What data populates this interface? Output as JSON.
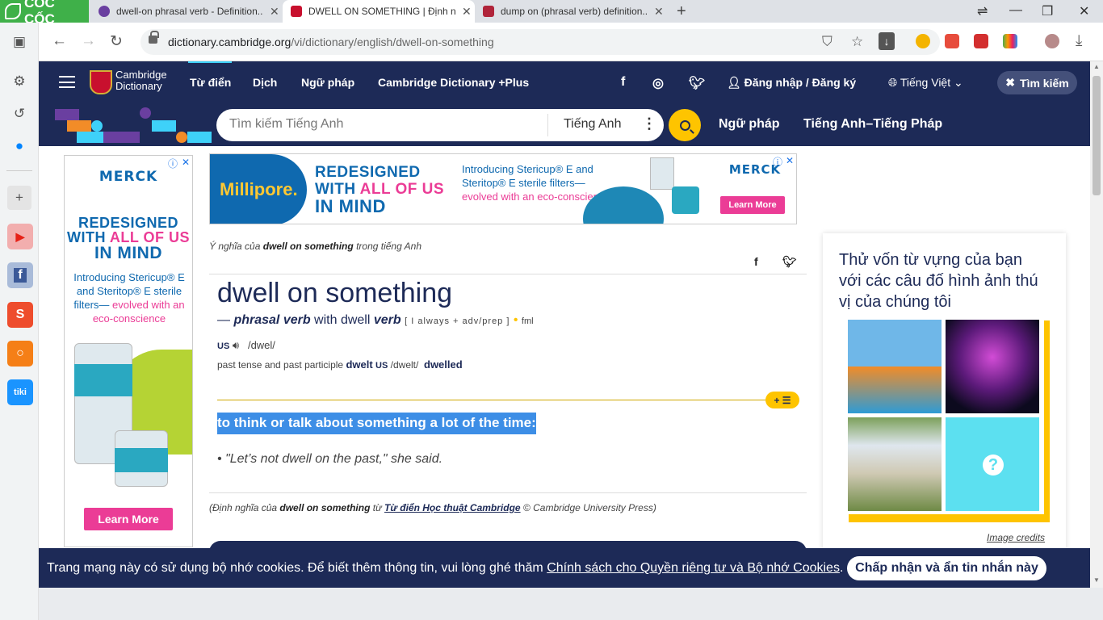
{
  "browser": {
    "brand": "CỐC CỐC",
    "tabs": [
      {
        "title": "dwell-on phrasal verb - Definition..."
      },
      {
        "title": "DWELL ON SOMETHING | Định ngh..."
      },
      {
        "title": "dump on (phrasal verb) definition..."
      }
    ],
    "url_domain": "dictionary.cambridge.org",
    "url_path": "/vi/dictionary/english/dwell-on-something"
  },
  "header": {
    "logo_line1": "Cambridge",
    "logo_line2": "Dictionary",
    "nav": [
      "Từ điển",
      "Dịch",
      "Ngữ pháp",
      "Cambridge Dictionary +Plus"
    ],
    "login": "Đăng nhập / Đăng ký",
    "language": "Tiếng Việt",
    "search_toggle": "Tìm kiếm"
  },
  "search": {
    "placeholder": "Tìm kiếm Tiếng Anh",
    "dictionary": "Tiếng Anh",
    "links": [
      "Ngữ pháp",
      "Tiếng Anh–Tiếng Pháp"
    ]
  },
  "ads": {
    "left": {
      "brand": "MERCK",
      "head1": "REDESIGNED",
      "head2a": "WITH ",
      "head2b": "ALL OF US",
      "head3": "IN MIND",
      "body1": "Introducing Stericup® E and Steritop® E sterile filters—",
      "body2": "evolved with an eco-conscience",
      "button": "Learn More"
    },
    "top": {
      "brand_left": "Millipore.",
      "head1": "REDESIGNED",
      "head2a": "WITH ",
      "head2b": "ALL OF US",
      "head3": "IN MIND",
      "body1": "Introducing Stericup® E and Steritop® E sterile filters—",
      "body2": "evolved with an eco-conscience",
      "brand_right": "MERCK",
      "button": "Learn More"
    }
  },
  "entry": {
    "breadcrumb_pre": "Ý nghĩa của ",
    "breadcrumb_word": "dwell on something",
    "breadcrumb_post": " trong tiếng Anh",
    "headword": "dwell on something",
    "pos_dash": "— ",
    "pos": "phrasal verb",
    "pos_with": " with dwell ",
    "pos_verb": "verb",
    "grammar": "[ I always + adv/prep ]",
    "register": "fml",
    "pron_region": "US",
    "pron_ipa": "/dwel/",
    "irreg_label": "past tense and past participle ",
    "irreg_form1": "dwelt",
    "irreg_region": "US",
    "irreg_ipa": "/dwelt/",
    "irreg_form2": "dwelled",
    "plus_label": "+ ☰",
    "definition": "to think or talk about something a lot of the time:",
    "example": "\"Let’s not dwell on the past,\" she said.",
    "credit_pre": "(Định nghĩa của ",
    "credit_word": "dwell on something",
    "credit_mid": " từ ",
    "credit_source": "Từ điển Học thuật Cambridge",
    "credit_post": " © Cambridge University Press)"
  },
  "quiz": {
    "title": "Thử vốn từ vựng của bạn với các câu đố hình ảnh thú vị của chúng tôi",
    "credits": "Image credits",
    "unknown_mark": "?"
  },
  "cookie": {
    "text_pre": "Trang mạng này có sử dụng bộ nhớ cookies. Để biết thêm thông tin, vui lòng ghé thăm ",
    "text_link": "Chính sách cho Quyền riêng tư và Bộ nhớ Cookies",
    "text_post": ".",
    "button": "Chấp nhận và ẩn tin nhắn này"
  },
  "colors": {
    "navy": "#1d2a57",
    "yellow": "#fec400",
    "highlight": "#3d8ee6",
    "coccoc_green": "#3fb049"
  },
  "icons": [
    "home-icon",
    "settings-icon",
    "history-icon",
    "messenger-icon",
    "youtube-icon",
    "facebook-icon",
    "shopee-icon",
    "search-app-icon",
    "tiki-icon",
    "facebook-icon",
    "instagram-icon",
    "twitter-icon",
    "user-icon",
    "globe-icon",
    "close-icon",
    "speaker-icon"
  ]
}
